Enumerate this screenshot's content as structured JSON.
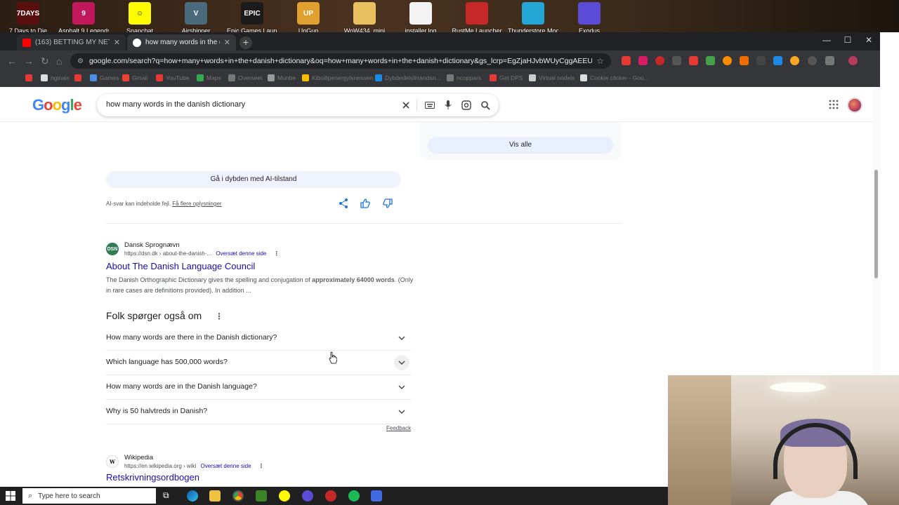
{
  "desktop": {
    "icons": [
      {
        "label": "7 Days to Die",
        "short": "7DAYS",
        "color": "#5a0f0f"
      },
      {
        "label": "Asphalt 9 Legends",
        "short": "9",
        "color": "#c2185b"
      },
      {
        "label": "Snapchat",
        "short": "☺",
        "color": "#fffc00"
      },
      {
        "label": "Airshipper",
        "short": "V",
        "color": "#4a6b7c"
      },
      {
        "label": "Epic Games Launcher",
        "short": "EPIC",
        "color": "#1b1b1b"
      },
      {
        "label": "UpGun",
        "short": "UP",
        "color": "#e0a030"
      },
      {
        "label": "WoW434_mini",
        "short": "",
        "color": "#e8c060"
      },
      {
        "label": "installer.log",
        "short": "",
        "color": "#f3f3f3"
      },
      {
        "label": "RustMe Launcher",
        "short": "",
        "color": "#c62828"
      },
      {
        "label": "Thunderstore Mod...",
        "short": "",
        "color": "#23a6d5"
      },
      {
        "label": "Exodus",
        "short": "",
        "color": "#5b4bd6"
      }
    ]
  },
  "browser": {
    "tabs": [
      {
        "title": "(163) BETTING MY NET WORTH...",
        "active": false
      },
      {
        "title": "how many words in the danis...",
        "active": true
      }
    ],
    "new_tab_label": "+",
    "url": "google.com/search?q=how+many+words+in+the+danish+dictionary&oq=how+many+words+in+the+danish+dictionary&gs_lcrp=EgZjaHJvbWUyCggAEEUYFhgeGDkyCg...",
    "bookmarks": [
      "",
      "nginais",
      "",
      "Games",
      "Gmail",
      "YouTube",
      "Maps",
      "Overseet",
      "Munbe",
      "Kiboillpenergylsnessen...",
      "Dybdedelsfinandsn...",
      "ncoppars",
      "Get DPS",
      "Virtual nodels",
      "Cookie clicker - Goo..."
    ]
  },
  "google": {
    "logo": "Google",
    "query": "how many words in the danish dictionary",
    "vis_alle": "Vis alle",
    "ai_button": "Gå i dybden med AI-tilstand",
    "ai_disclaimer": "AI-svar kan indeholde fejl.",
    "ai_more_info": "Få flere oplysninger",
    "result1": {
      "favicon": "DSN",
      "source": "Dansk Sprognævn",
      "url": "https://dsn.dk › about-the-danish-...",
      "translate": "Oversæt denne side",
      "title": "About The Danish Language Council",
      "snippet_a": "The Danish Orthographic Dictionary gives the spelling and conjugation of ",
      "snippet_bold": "approximately 64000 words",
      "snippet_b": ". (Only in rare cases are definitions provided). In addition ..."
    },
    "paa_title": "Folk spørger også om",
    "paa": [
      "How many words are there in the Danish dictionary?",
      "Which language has 500,000 words?",
      "How many words are in the Danish language?",
      "Why is 50 halvtreds in Danish?"
    ],
    "feedback": "Feedback",
    "result2": {
      "favicon": "W",
      "source": "Wikipedia",
      "url": "https://en.wikipedia.org › wiki",
      "translate": "Oversæt denne side",
      "title": "Retskrivningsordbogen"
    }
  },
  "taskbar": {
    "search_placeholder": "Type here to search"
  }
}
